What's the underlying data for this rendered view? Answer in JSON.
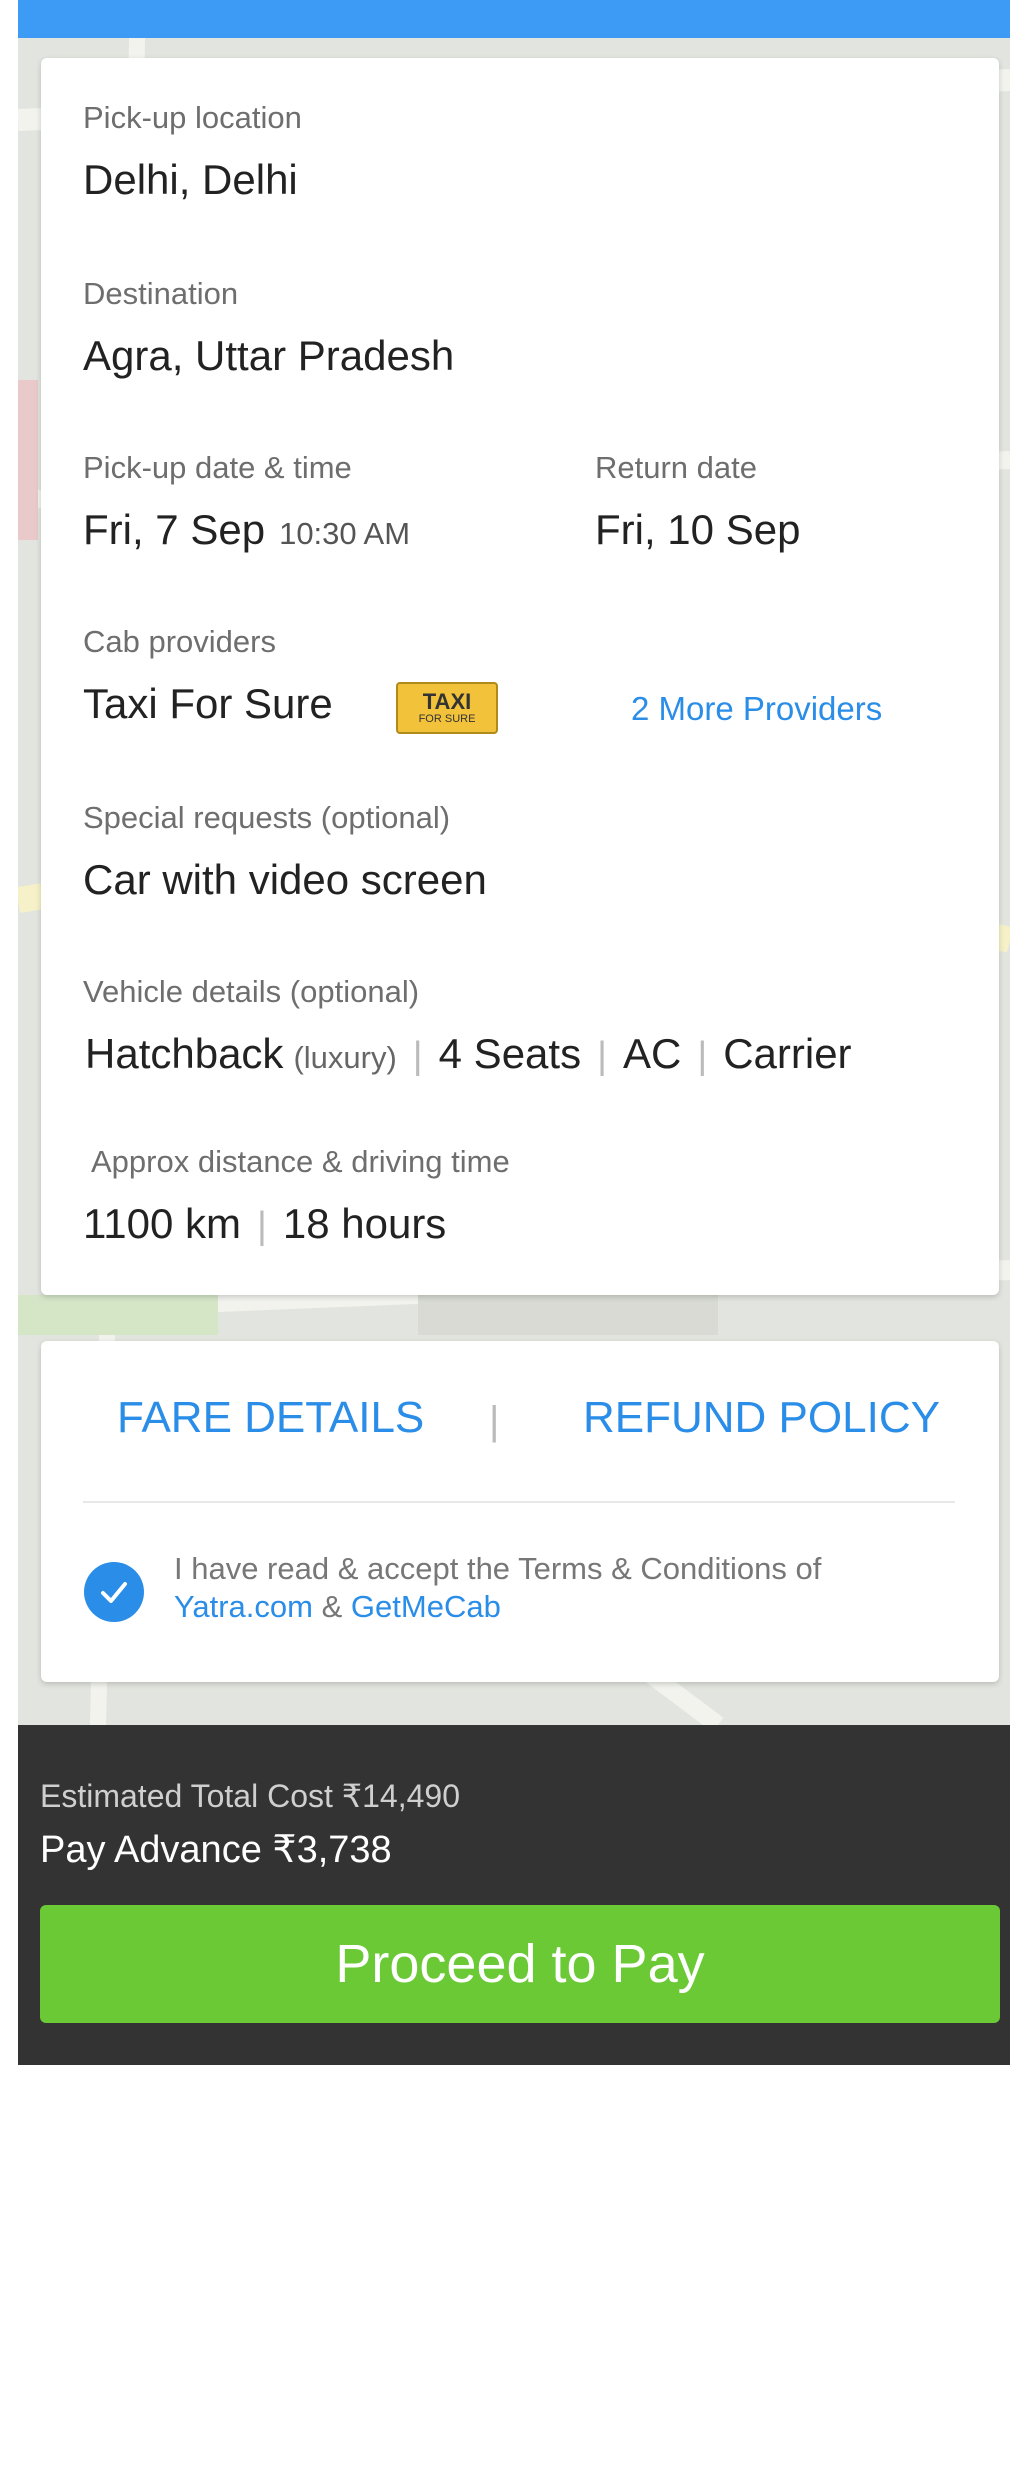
{
  "booking": {
    "pickup_label": "Pick-up location",
    "pickup_value": "Delhi, Delhi",
    "destination_label": "Destination",
    "destination_value": "Agra, Uttar Pradesh",
    "pickup_datetime_label": "Pick-up date & time",
    "pickup_date": "Fri, 7 Sep",
    "pickup_time": "10:30 AM",
    "return_label": "Return date",
    "return_date": "Fri, 10 Sep",
    "cab_label": "Cab providers",
    "cab_value": "Taxi For Sure",
    "cab_logo_line1": "TAXI",
    "cab_logo_line2": "FOR SURE",
    "more_providers": "2 More Providers",
    "special_label": "Special requests (optional)",
    "special_value": "Car with video screen",
    "vehicle_label": "Vehicle details (optional)",
    "vehicle_type": "Hatchback",
    "vehicle_class": "(luxury)",
    "vehicle_seats": "4 Seats",
    "vehicle_ac": "AC",
    "vehicle_carrier": "Carrier",
    "distance_label": "Approx distance & driving time",
    "distance_value": "1100 km",
    "time_value": "18 hours",
    "separator": "|"
  },
  "policy": {
    "fare_details": "FARE DETAILS",
    "refund_policy": "REFUND POLICY",
    "separator": "|",
    "terms_line1": "I have read & accept the Terms & Conditions of",
    "terms_link1": "Yatra.com",
    "terms_amp": "&",
    "terms_link2": "GetMeCab"
  },
  "footer": {
    "estimated_label": "Estimated Total Cost",
    "estimated_value": "₹14,490",
    "advance_label": "Pay Advance",
    "advance_value": "₹3,738",
    "pay_button": "Proceed to Pay"
  },
  "colors": {
    "accent": "#2a8de8",
    "pay_button": "#6bc935",
    "footer_bg": "#333333",
    "topbar": "#3d9bf5"
  },
  "icons": {
    "check": "checkmark-icon",
    "map": "map-background"
  }
}
